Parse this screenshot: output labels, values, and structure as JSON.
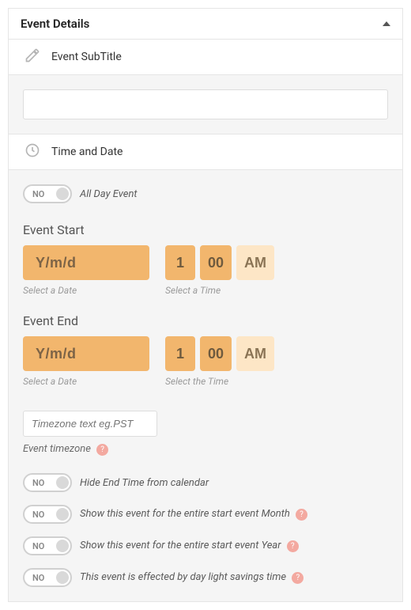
{
  "panel": {
    "title": "Event Details"
  },
  "subtitle_section": {
    "label": "Event SubTitle",
    "value": ""
  },
  "timedate_section": {
    "label": "Time and Date"
  },
  "toggles": {
    "no": "NO",
    "all_day": "All Day Event",
    "hide_end": "Hide End Time from calendar",
    "show_month": "Show this event for the entire start event Month",
    "show_year": "Show this event for the entire start event Year",
    "dst": "This event is effected by day light savings time",
    "help": "?"
  },
  "start": {
    "title": "Event Start",
    "date_ph": "Y/m/d",
    "date_hint": "Select a Date",
    "hour": "1",
    "minute": "00",
    "ampm": "AM",
    "time_hint": "Select a Time"
  },
  "end": {
    "title": "Event End",
    "date_ph": "Y/m/d",
    "date_hint": "Select a Date",
    "hour": "1",
    "minute": "00",
    "ampm": "AM",
    "time_hint": "Select the Time"
  },
  "timezone": {
    "placeholder": "Timezone text eg.PST",
    "label": "Event timezone"
  }
}
